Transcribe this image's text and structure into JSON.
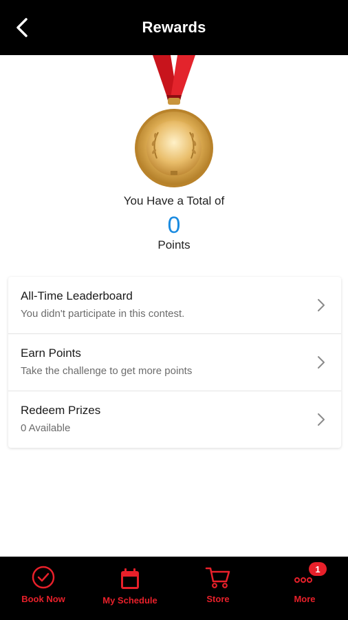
{
  "header": {
    "title": "Rewards",
    "back_icon": "chevron-left-icon"
  },
  "summary": {
    "total_label": "You Have a Total of",
    "points_value": "0",
    "points_label": "Points",
    "medal_icon": "gold-medal-icon"
  },
  "menu": {
    "items": [
      {
        "title": "All-Time Leaderboard",
        "subtitle": "You didn't participate in this contest."
      },
      {
        "title": "Earn Points",
        "subtitle": "Take the challenge to get more points"
      },
      {
        "title": "Redeem Prizes",
        "subtitle": "0 Available"
      }
    ]
  },
  "bottom_nav": {
    "tabs": [
      {
        "label": "Book Now",
        "icon": "check-circle-icon"
      },
      {
        "label": "My Schedule",
        "icon": "calendar-icon"
      },
      {
        "label": "Store",
        "icon": "cart-icon"
      },
      {
        "label": "More",
        "icon": "more-dots-icon",
        "badge": "1"
      }
    ]
  },
  "colors": {
    "accent": "#e8202a",
    "points": "#1a8be0",
    "bar": "#000000"
  }
}
